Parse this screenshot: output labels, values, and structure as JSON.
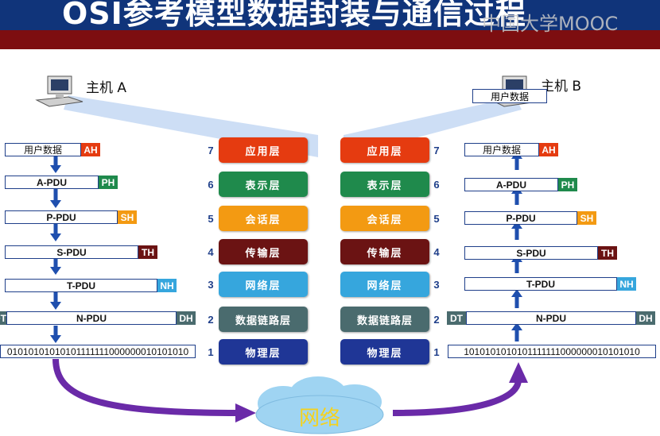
{
  "title": "OSI参考模型数据封装与通信过程",
  "watermark": "中国大学MOOC",
  "host_a": {
    "label": "主机 A"
  },
  "host_b": {
    "label": "主机 B",
    "screen_text": "用户数据"
  },
  "layers": [
    {
      "num": "7",
      "name": "应用层",
      "color": "#e53b10"
    },
    {
      "num": "6",
      "name": "表示层",
      "color": "#1f8a4c"
    },
    {
      "num": "5",
      "name": "会话层",
      "color": "#f39a12"
    },
    {
      "num": "4",
      "name": "传输层",
      "color": "#6b1313"
    },
    {
      "num": "3",
      "name": "网络层",
      "color": "#36a6dd"
    },
    {
      "num": "2",
      "name": "数据链路层",
      "color": "#4a6b6e"
    },
    {
      "num": "1",
      "name": "物理层",
      "color": "#1f3696"
    }
  ],
  "encapsulation": {
    "user_data": "用户数据",
    "pdus": [
      "A-PDU",
      "P-PDU",
      "S-PDU",
      "T-PDU",
      "N-PDU"
    ],
    "headers": [
      {
        "label": "AH",
        "color": "#e53b10"
      },
      {
        "label": "PH",
        "color": "#1f8a4c"
      },
      {
        "label": "SH",
        "color": "#f39a12"
      },
      {
        "label": "TH",
        "color": "#6b1313"
      },
      {
        "label": "NH",
        "color": "#36a6dd"
      },
      {
        "label": "DH",
        "color": "#4a6b6e"
      },
      {
        "label": "DT",
        "color": "#4a6b6e"
      }
    ],
    "bits_a": "01010101010101111111000000010101010",
    "bits_b": "1010101010101111111000000010101010"
  },
  "network": {
    "label": "网络"
  },
  "colors": {
    "title_blue": "#10347a",
    "title_red": "#7d0e10",
    "arrow_blue": "#1f4fae",
    "arrow_purple": "#6a2aa8",
    "cloud": "#9fd4f2"
  }
}
